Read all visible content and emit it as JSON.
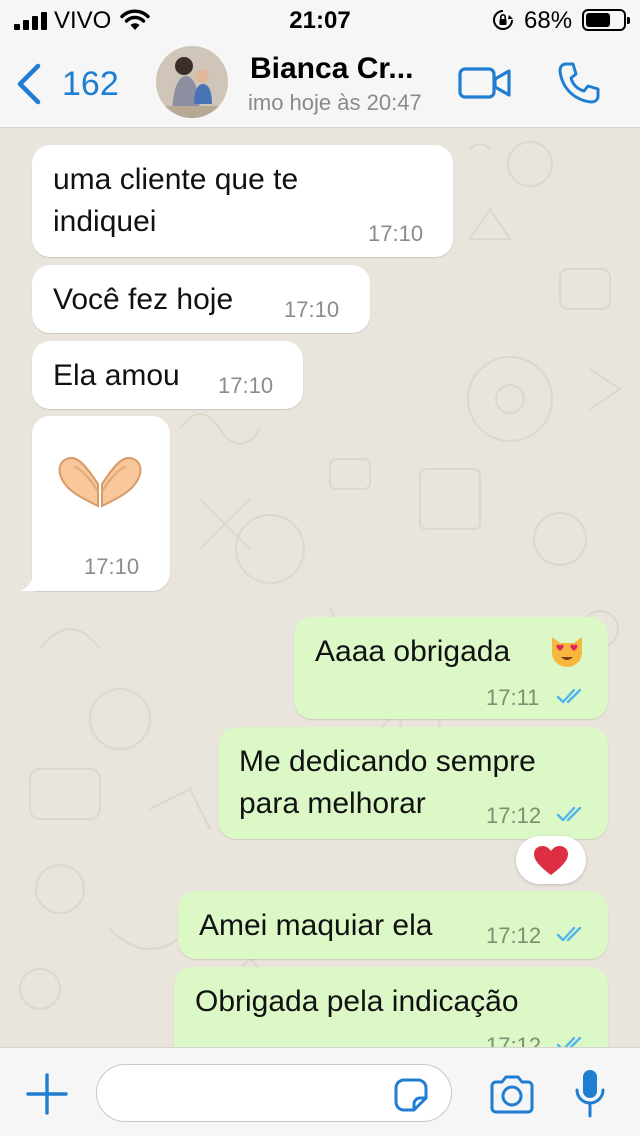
{
  "status_bar": {
    "carrier": "VIVO",
    "time": "21:07",
    "battery_percent": "68%",
    "battery_level": 0.68,
    "icons": [
      "signal-icon",
      "wifi-icon",
      "orientation-lock-icon",
      "battery-icon"
    ]
  },
  "header": {
    "back_count": "162",
    "contact_name": "Bianca Cr...",
    "last_seen": "imo hoje às 20:47",
    "icons": [
      "chevron-left-icon",
      "video-call-icon",
      "phone-icon"
    ]
  },
  "messages": [
    {
      "direction": "in",
      "text": "uma cliente que te\nindiquei",
      "time": "17:10"
    },
    {
      "direction": "in",
      "text": "Você fez hoje",
      "time": "17:10"
    },
    {
      "direction": "in",
      "text": "Ela amou",
      "time": "17:10"
    },
    {
      "direction": "in",
      "emoji": "heart-hands-emoji",
      "time": "17:10"
    },
    {
      "direction": "out",
      "text": "Aaaa obrigada",
      "emoji": "heart-eyes-cat-emoji",
      "time": "17:11",
      "status": "read"
    },
    {
      "direction": "out",
      "text": "Me dedicando sempre\npara melhorar",
      "time": "17:12",
      "status": "read",
      "reaction": "red-heart-emoji"
    },
    {
      "direction": "out",
      "text": "Amei maquiar ela",
      "time": "17:12",
      "status": "read"
    },
    {
      "direction": "out",
      "text": "Obrigada pela indicação",
      "time": "17:12",
      "status": "read"
    }
  ],
  "composer": {
    "placeholder": "",
    "icons": [
      "plus-icon",
      "sticker-icon",
      "camera-icon",
      "microphone-icon"
    ]
  },
  "colors": {
    "accent": "#1f7ed1",
    "incoming_bubble": "#ffffff",
    "outgoing_bubble": "#dcf8c6",
    "read_ticks": "#4fb5ec",
    "chat_background": "#e9e4dc"
  }
}
